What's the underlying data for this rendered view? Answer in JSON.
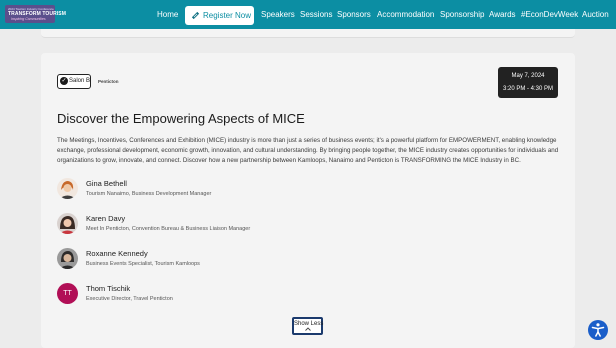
{
  "header": {
    "logo_line1": "2024 Tourism Industry Conference",
    "logo_line2": "TRANSFORM TOURISM",
    "logo_line3": "Inspiring Communities",
    "register_label": "Register Now",
    "nav": [
      {
        "label": "Home"
      },
      {
        "label": "Speakers"
      },
      {
        "label": "Sessions"
      },
      {
        "label": "Sponsors"
      },
      {
        "label": "Accommodation"
      },
      {
        "label": "Sponsorship"
      },
      {
        "label": "Awards"
      },
      {
        "label": "#EconDevWeek"
      },
      {
        "label": "Auction"
      }
    ]
  },
  "session": {
    "room": "Salon B",
    "partner_logo": "Penticton",
    "date": "May 7, 2024",
    "time": "3:20 PM - 4:30 PM",
    "title": "Discover the Empowering Aspects of MICE",
    "description": "The Meetings, Incentives, Conferences and Exhibition (MICE) industry is more than just a series of business events; it's a powerful platform for EMPOWERMENT, enabling knowledge exchange, professional development, economic growth, innovation, and cultural understanding. By bringing people together, the MICE industry creates opportunities for individuals and organizations to grow, innovate, and connect. Discover how a new partnership between Kamloops, Nanaimo and Penticton is TRANSFORMING the MICE Industry in BC.",
    "speakers": [
      {
        "name": "Gina Bethell",
        "role": "Tourism Nanaimo, Business Development Manager"
      },
      {
        "name": "Karen Davy",
        "role": "Meet In Penticton, Convention Bureau & Business Liaison Manager"
      },
      {
        "name": "Roxanne Kennedy",
        "role": "Business Events Specialist, Tourism Kamloops"
      },
      {
        "name": "Thom Tischik",
        "role": "Executive Director, Travel Penticton",
        "initials": "TT"
      }
    ],
    "show_less_label": "Show Less",
    "show_less_icon": "chevron-up-icon"
  },
  "accessibility_icon": "accessibility-icon",
  "colors": {
    "header_bg": "#0c8ea3",
    "date_box_bg": "#222222",
    "initials_avatar_bg": "#b10f56",
    "accessibility_bg": "#1a5ec9",
    "show_less_border": "#1b3a6d"
  }
}
